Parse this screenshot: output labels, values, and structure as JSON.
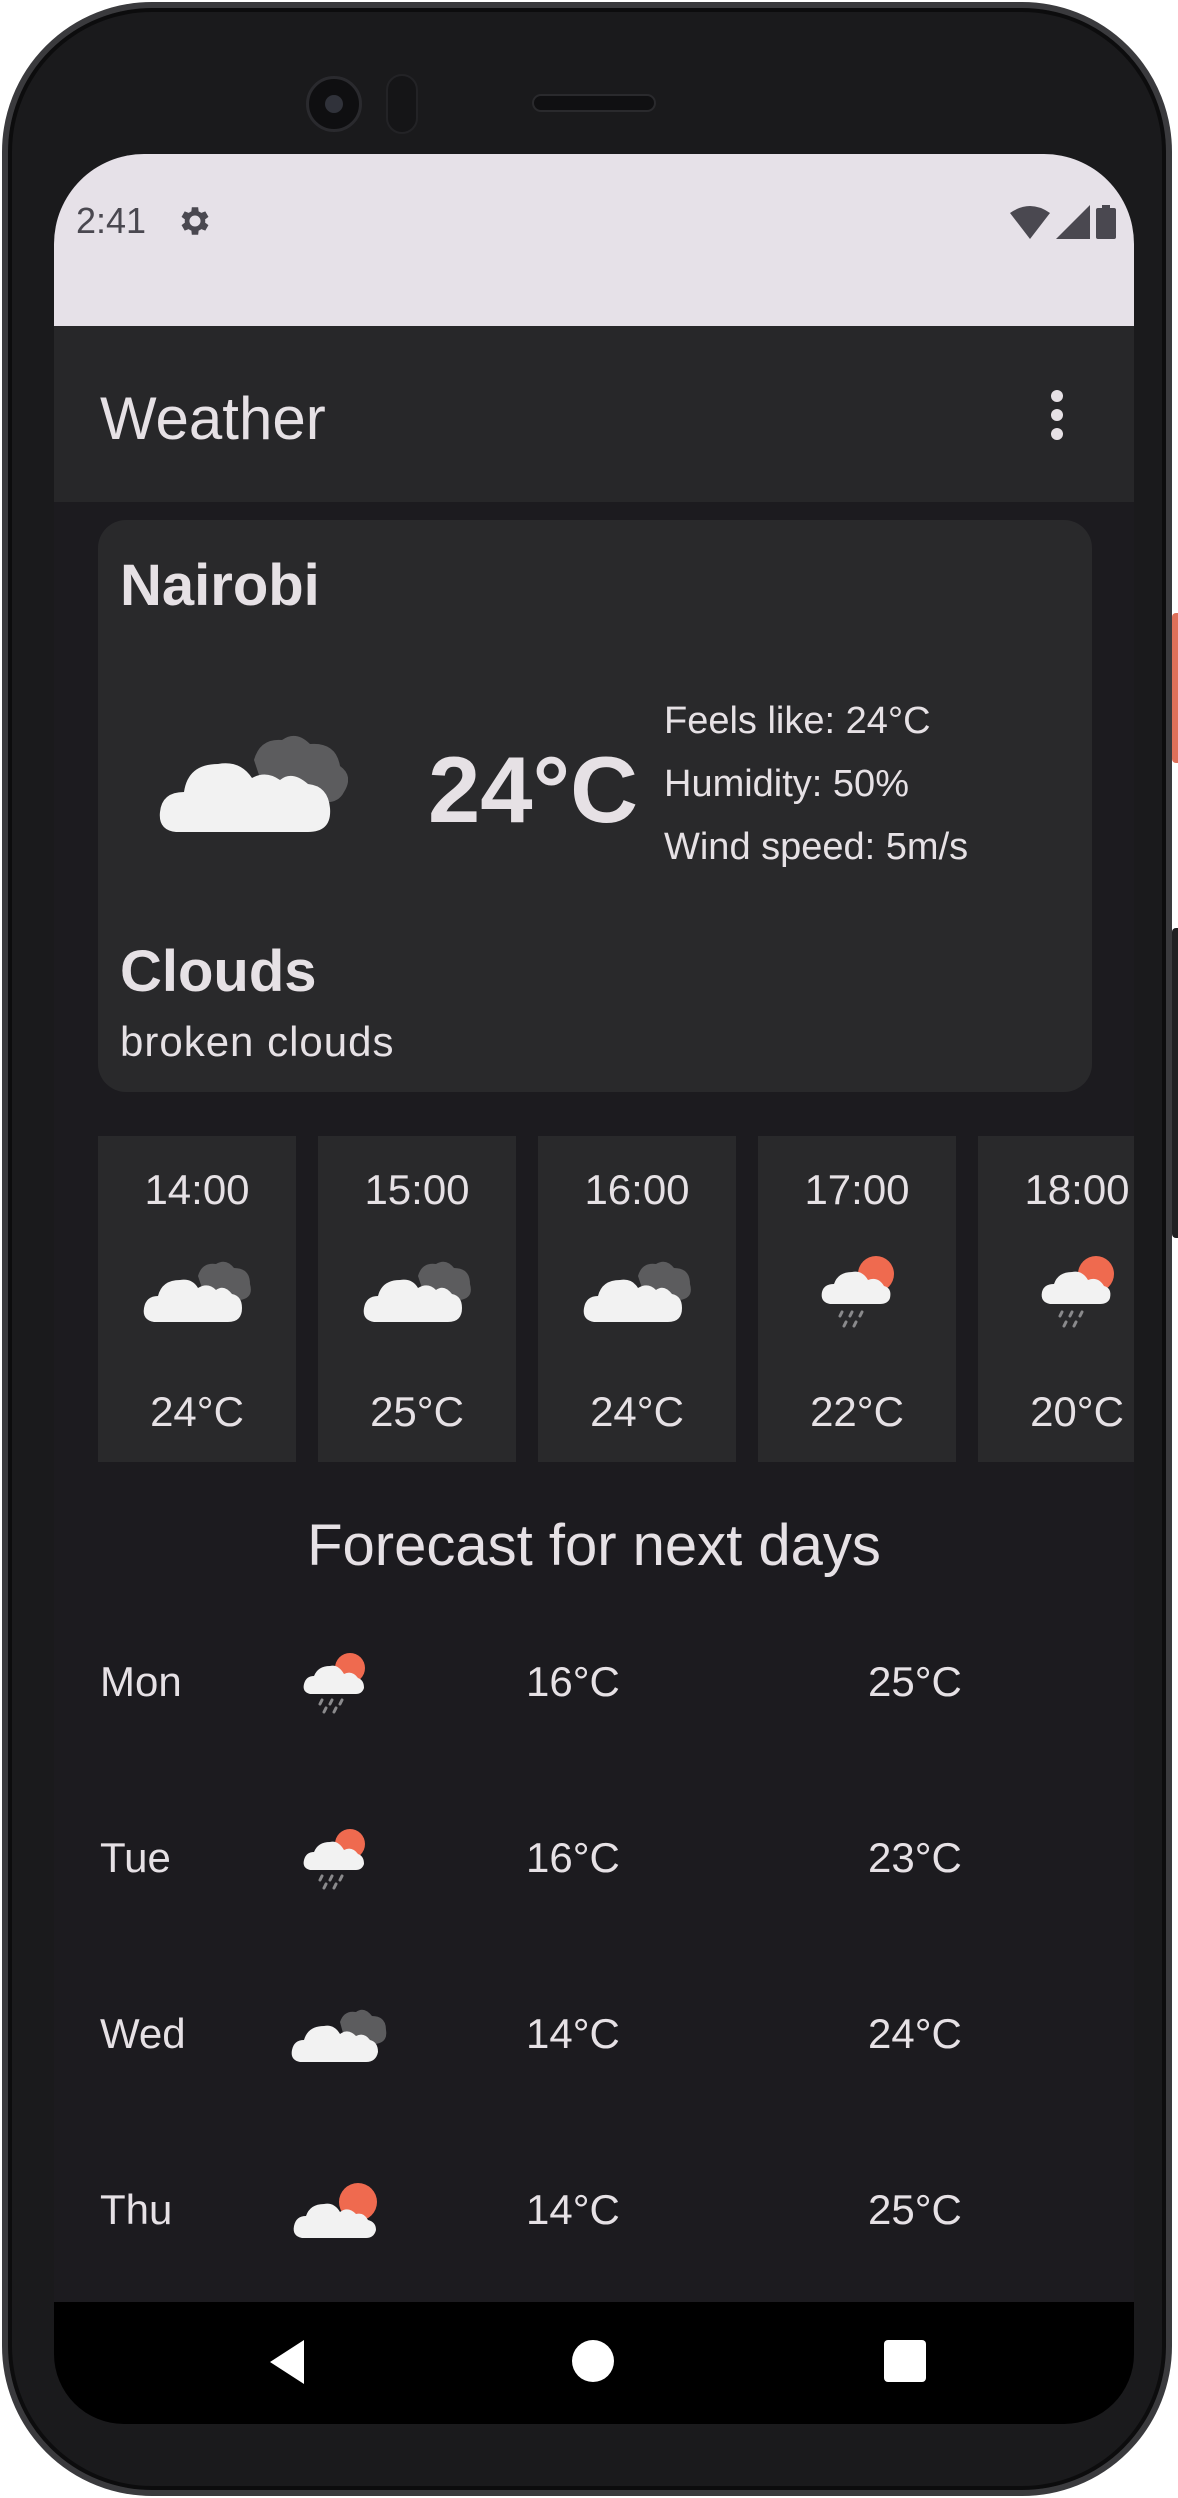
{
  "status_bar": {
    "time": "2:41",
    "icons": [
      "gear-icon",
      "wifi-icon",
      "signal-icon",
      "battery-icon"
    ]
  },
  "app_bar": {
    "title": "Weather",
    "menu_icon": "more-vert-icon"
  },
  "current": {
    "city": "Nairobi",
    "icon": "broken-clouds-icon",
    "temperature": "24°C",
    "feels_like": "Feels like: 24°C",
    "humidity": "Humidity: 50%",
    "wind_speed": "Wind speed: 5m/s",
    "condition": "Clouds",
    "description": "broken clouds"
  },
  "hourly": [
    {
      "time": "14:00",
      "icon": "broken-clouds-icon",
      "temp": "24°C"
    },
    {
      "time": "15:00",
      "icon": "broken-clouds-icon",
      "temp": "25°C"
    },
    {
      "time": "16:00",
      "icon": "broken-clouds-icon",
      "temp": "24°C"
    },
    {
      "time": "17:00",
      "icon": "rain-sun-icon",
      "temp": "22°C"
    },
    {
      "time": "18:00",
      "icon": "rain-sun-icon",
      "temp": "20°C"
    }
  ],
  "forecast": {
    "title": "Forecast for next days",
    "days": [
      {
        "day": "Mon",
        "icon": "rain-sun-icon",
        "low": "16°C",
        "high": "25°C"
      },
      {
        "day": "Tue",
        "icon": "rain-sun-icon",
        "low": "16°C",
        "high": "23°C"
      },
      {
        "day": "Wed",
        "icon": "broken-clouds-icon",
        "low": "14°C",
        "high": "24°C"
      },
      {
        "day": "Thu",
        "icon": "few-clouds-icon",
        "low": "14°C",
        "high": "25°C"
      }
    ]
  },
  "nav_bar": {
    "icons": [
      "back-icon",
      "home-icon",
      "recents-icon"
    ]
  },
  "colors": {
    "background": "#1c1b1f",
    "card": "#29292b",
    "text": "#e6e1e5",
    "sun": "#ef6a4f",
    "status_bar": "#e6e1e8"
  }
}
